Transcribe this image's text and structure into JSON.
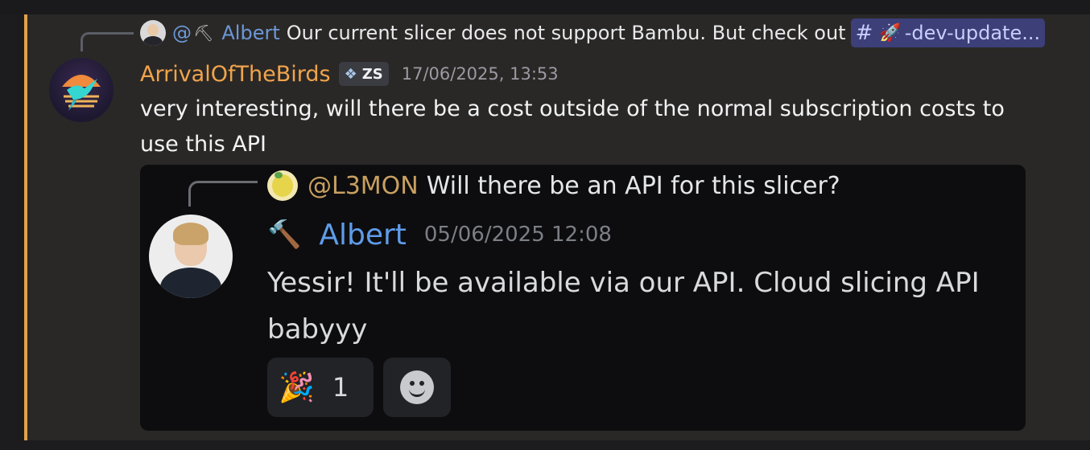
{
  "reply": {
    "at": "@",
    "name": "Albert",
    "text": "Our current slicer does not support Bambu. But check out",
    "channel": "-dev-update..."
  },
  "message": {
    "author": "ArrivalOfTheBirds",
    "tag": "ZS",
    "timestamp": "17/06/2025, 13:53",
    "text": "very interesting, will there be a cost outside of the normal subscription costs to use this API"
  },
  "embed": {
    "reply_mention": "@L3MON",
    "reply_text": "Will there be an API for this slicer?",
    "author": "Albert",
    "timestamp": "05/06/2025 12:08",
    "text": "Yessir! It'll be available via our API. Cloud slicing API babyyy",
    "reactions": [
      {
        "emoji": "party-popper-icon",
        "count": "1"
      },
      {
        "emoji": "add-reaction-icon"
      }
    ]
  },
  "colors": {
    "author": "#f1a44c",
    "accent_bar": "#e0a24c",
    "mention_link": "#6b98d8",
    "channel_chip_bg": "#3c3f78"
  }
}
